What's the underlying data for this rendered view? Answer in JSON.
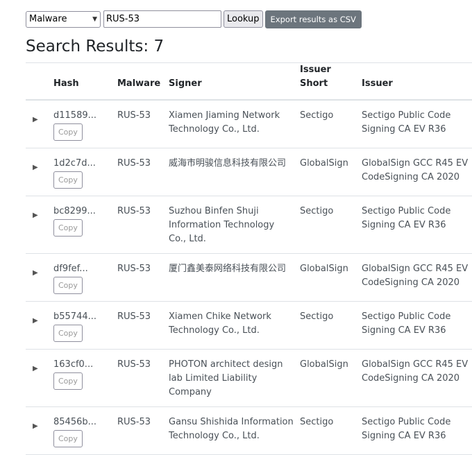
{
  "toolbar": {
    "type_select_value": "Malware",
    "search_value": "RUS-53",
    "lookup_label": "Lookup",
    "export_label": "Export results as CSV"
  },
  "results": {
    "heading": "Search Results: 7"
  },
  "table": {
    "headers": {
      "hash": "Hash",
      "malware": "Malware",
      "signer": "Signer",
      "issuer_short": "Issuer Short",
      "issuer": "Issuer"
    },
    "toggle_glyph": "▶",
    "copy_label": "Copy",
    "rows": [
      {
        "hash": "d11589...",
        "malware": "RUS-53",
        "signer": "Xiamen Jiaming Network Technology Co., Ltd.",
        "issuer_short": "Sectigo",
        "issuer": "Sectigo Public Code Signing CA EV R36"
      },
      {
        "hash": "1d2c7d...",
        "malware": "RUS-53",
        "signer": "威海市明骏信息科技有限公司",
        "issuer_short": "GlobalSign",
        "issuer": "GlobalSign GCC R45 EV CodeSigning CA 2020"
      },
      {
        "hash": "bc8299...",
        "malware": "RUS-53",
        "signer": "Suzhou Binfen Shuji Information Technology Co., Ltd.",
        "issuer_short": "Sectigo",
        "issuer": "Sectigo Public Code Signing CA EV R36"
      },
      {
        "hash": "df9fef...",
        "malware": "RUS-53",
        "signer": "厦门鑫美泰网络科技有限公司",
        "issuer_short": "GlobalSign",
        "issuer": "GlobalSign GCC R45 EV CodeSigning CA 2020"
      },
      {
        "hash": "b55744...",
        "malware": "RUS-53",
        "signer": "Xiamen Chike Network Technology Co., Ltd.",
        "issuer_short": "Sectigo",
        "issuer": "Sectigo Public Code Signing CA EV R36"
      },
      {
        "hash": "163cf0...",
        "malware": "RUS-53",
        "signer": "PHOTON architect design lab Limited Liability Company",
        "issuer_short": "GlobalSign",
        "issuer": "GlobalSign GCC R45 EV CodeSigning CA 2020"
      },
      {
        "hash": "85456b...",
        "malware": "RUS-53",
        "signer": "Gansu Shishida Information Technology Co., Ltd.",
        "issuer_short": "Sectigo",
        "issuer": "Sectigo Public Code Signing CA EV R36"
      }
    ]
  }
}
